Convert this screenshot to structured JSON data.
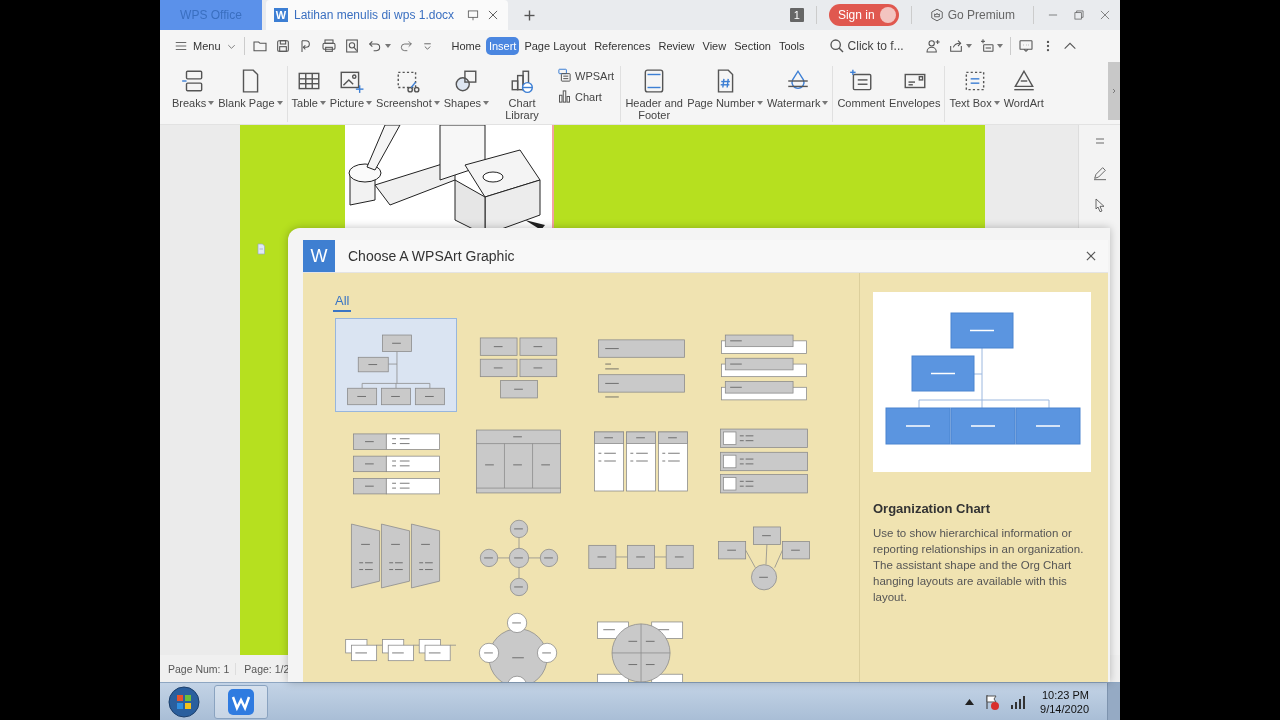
{
  "tabs": [
    {
      "label": "WPS Office",
      "kind": "home",
      "selected": false
    },
    {
      "label": "Latihan menulis di wps 1.docx",
      "kind": "document",
      "logo": "W",
      "selected": true
    }
  ],
  "title_bar": {
    "window_count": "1",
    "sign_in": "Sign in",
    "premium": "Go Premium"
  },
  "menu": {
    "label": "Menu"
  },
  "ribbon_tabs": [
    {
      "label": "Home",
      "selected": false
    },
    {
      "label": "Insert",
      "selected": true
    },
    {
      "label": "Page Layout",
      "selected": false
    },
    {
      "label": "References",
      "selected": false
    },
    {
      "label": "Review",
      "selected": false
    },
    {
      "label": "View",
      "selected": false
    },
    {
      "label": "Section",
      "selected": false
    },
    {
      "label": "Tools",
      "selected": false
    }
  ],
  "search": {
    "label": "Click to f..."
  },
  "ribbon": {
    "groups": [
      {
        "items": [
          {
            "label": "Breaks",
            "kind": "large",
            "dropdown": true
          },
          {
            "label": "Blank Page",
            "kind": "large",
            "dropdown": true
          }
        ]
      },
      {
        "items": [
          {
            "label": "Table",
            "kind": "large",
            "dropdown": true
          },
          {
            "label": "Picture",
            "kind": "large",
            "dropdown": true
          },
          {
            "label": "Screenshot",
            "kind": "large",
            "dropdown": true
          },
          {
            "label": "Shapes",
            "kind": "large",
            "dropdown": true
          },
          {
            "label": "Chart Library",
            "kind": "large",
            "dropdown": false
          },
          {
            "label": "WPSArt",
            "kind": "small",
            "dropdown": false
          },
          {
            "label": "Chart",
            "kind": "small",
            "dropdown": false
          }
        ]
      },
      {
        "items": [
          {
            "label": "Header and Footer",
            "kind": "large",
            "dropdown": false
          },
          {
            "label": "Page Number",
            "kind": "large",
            "dropdown": true
          },
          {
            "label": "Watermark",
            "kind": "large",
            "dropdown": true
          }
        ]
      },
      {
        "items": [
          {
            "label": "Comment",
            "kind": "large",
            "dropdown": false
          },
          {
            "label": "Envelopes",
            "kind": "large",
            "dropdown": false
          }
        ]
      },
      {
        "items": [
          {
            "label": "Text Box",
            "kind": "large",
            "dropdown": true
          },
          {
            "label": "WordArt",
            "kind": "large",
            "dropdown": false
          }
        ]
      }
    ]
  },
  "status_bar": [
    "Page Num: 1",
    "Page: 1/2"
  ],
  "dialog": {
    "logo": "W",
    "title": "Choose A WPSArt Graphic",
    "categories": [
      {
        "label": "All",
        "selected": true
      }
    ],
    "thumbnails": [
      {
        "kind": "hierarchy",
        "selected": true
      },
      {
        "kind": "grid",
        "selected": false
      },
      {
        "kind": "list",
        "selected": false
      },
      {
        "kind": "tabbed-list",
        "selected": false
      },
      {
        "kind": "bullet-list",
        "selected": false
      },
      {
        "kind": "table",
        "selected": false
      },
      {
        "kind": "columns",
        "selected": false
      },
      {
        "kind": "checklist",
        "selected": false
      },
      {
        "kind": "chevron",
        "selected": false
      },
      {
        "kind": "radial",
        "selected": false
      },
      {
        "kind": "process",
        "selected": false
      },
      {
        "kind": "converge",
        "selected": false
      },
      {
        "kind": "step-process",
        "selected": false
      },
      {
        "kind": "cycle",
        "selected": false
      },
      {
        "kind": "quadrant",
        "selected": false
      }
    ],
    "preview": {
      "title": "Organization Chart",
      "description": "Use to show hierarchical information or reporting relationships in an organization. The assistant shape and the Org Chart hanging layouts are available with this layout."
    }
  },
  "taskbar": {
    "time": "10:23 PM",
    "date": "9/14/2020"
  }
}
